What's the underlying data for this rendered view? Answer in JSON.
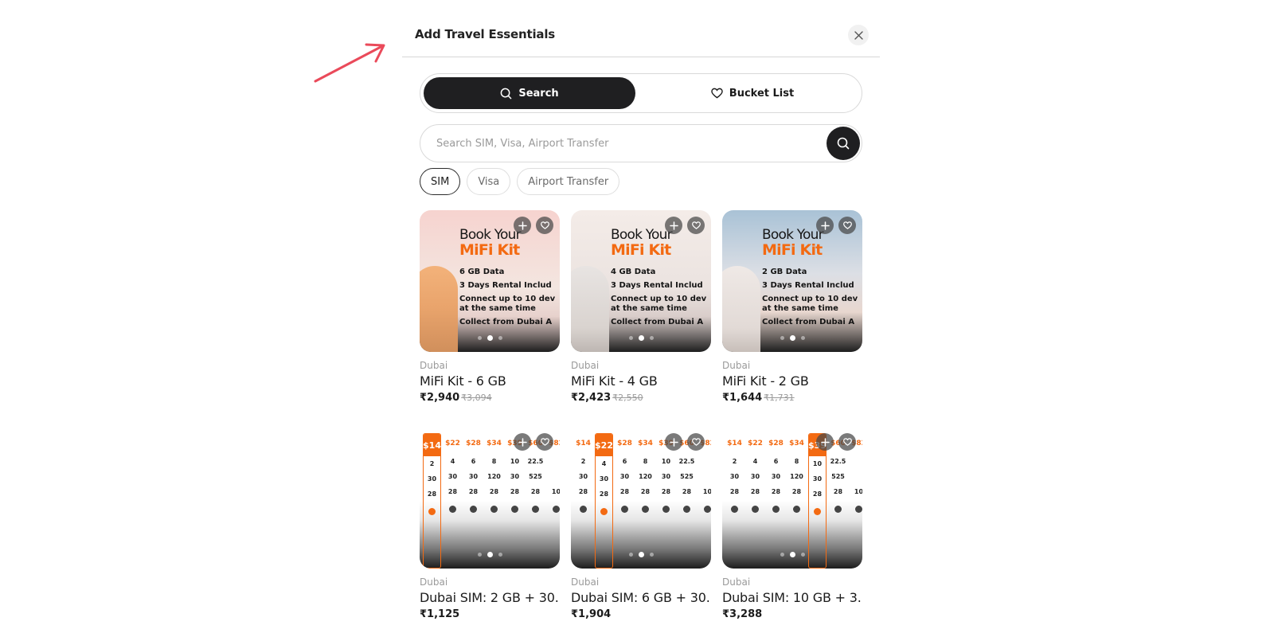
{
  "panel": {
    "title": "Add Travel Essentials",
    "close_icon": "close-icon"
  },
  "tabs": {
    "search_label": "Search",
    "bucket_label": "Bucket List"
  },
  "search": {
    "placeholder": "Search SIM, Visa, Airport Transfer"
  },
  "filters": [
    "SIM",
    "Visa",
    "Airport Transfer"
  ],
  "active_filter": "SIM",
  "colors": {
    "accent_orange": "#f36a12",
    "dark": "#1f1f21",
    "annotation_arrow": "#ea4a5a"
  },
  "products": [
    {
      "location": "Dubai",
      "name": "MiFi Kit - 6 GB",
      "price": "₹2,940",
      "old_price": "₹3,094",
      "promo": {
        "line1": "Book Your",
        "line2": "MiFi Kit",
        "data": "6 GB",
        "data_suffix": " Data",
        "rental": "3 Days",
        "rental_suffix": " Rental Includ",
        "connect": "Connect up to 10 dev",
        "connect2": "at the same time",
        "collect": "Collect from Dubai A"
      }
    },
    {
      "location": "Dubai",
      "name": "MiFi Kit - 4 GB",
      "price": "₹2,423",
      "old_price": "₹2,550",
      "promo": {
        "line1": "Book Your",
        "line2": "MiFi Kit",
        "data": "4 GB",
        "data_suffix": " Data",
        "rental": "3 Days",
        "rental_suffix": " Rental Includ",
        "connect": "Connect up to 10 dev",
        "connect2": "at the same time",
        "collect": "Collect from Dubai A"
      }
    },
    {
      "location": "Dubai",
      "name": "MiFi Kit - 2 GB",
      "price": "₹1,644",
      "old_price": "₹1,731",
      "promo": {
        "line1": "Book Your",
        "line2": "MiFi Kit",
        "data": "2 GB",
        "data_suffix": " Data",
        "rental": "3 Days",
        "rental_suffix": " Rental Includ",
        "connect": "Connect up to 10 dev",
        "connect2": "at the same time",
        "collect": "Collect from Dubai A"
      }
    },
    {
      "location": "Dubai",
      "name": "Dubai SIM: 2 GB + 30...",
      "price": "₹1,125"
    },
    {
      "location": "Dubai",
      "name": "Dubai SIM: 6 GB + 30...",
      "price": "₹1,904"
    },
    {
      "location": "Dubai",
      "name": "Dubai SIM: 10 GB + 3...",
      "price": "₹3,288"
    }
  ],
  "plan_columns": [
    {
      "price": "$14",
      "data": "2",
      "mins": "30",
      "days": "28"
    },
    {
      "price": "$22",
      "data": "4",
      "mins": "30",
      "days": "28"
    },
    {
      "price": "$28",
      "data": "6",
      "mins": "30",
      "days": "28"
    },
    {
      "price": "$34",
      "data": "8",
      "mins": "120",
      "days": "28"
    },
    {
      "price": "$39",
      "data": "10",
      "mins": "30",
      "days": "28"
    },
    {
      "price": "$60",
      "data": "22.5",
      "mins": "525",
      "days": "28"
    },
    {
      "price": "$82",
      "data": "",
      "mins": "",
      "days": "10"
    }
  ],
  "plan_selected": [
    0,
    1,
    4
  ]
}
